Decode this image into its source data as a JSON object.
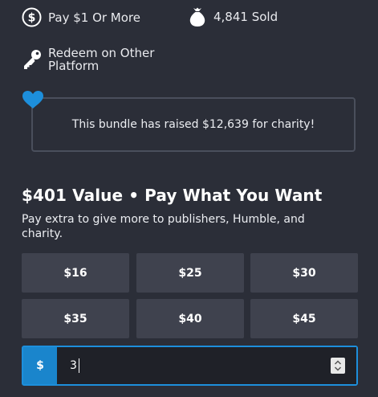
{
  "stats": {
    "pay": {
      "label": "Pay $1 Or More",
      "icon": "dollar-circle-icon"
    },
    "sold": {
      "label": "4,841 Sold",
      "icon": "money-bag-icon"
    },
    "redeem": {
      "label": "Redeem on Other Platform",
      "icon": "key-icon"
    }
  },
  "charity": {
    "icon": "heart-icon",
    "message": "This bundle has raised $12,639 for charity!",
    "accent_color": "#1d8fdc"
  },
  "purchase": {
    "title": "$401 Value • Pay What You Want",
    "subtitle": "Pay extra to give more to publishers, Humble, and charity.",
    "amount_options": [
      "$16",
      "$25",
      "$30",
      "$35",
      "$40",
      "$45"
    ],
    "custom_amount": {
      "currency_symbol": "$",
      "value": "3"
    }
  }
}
